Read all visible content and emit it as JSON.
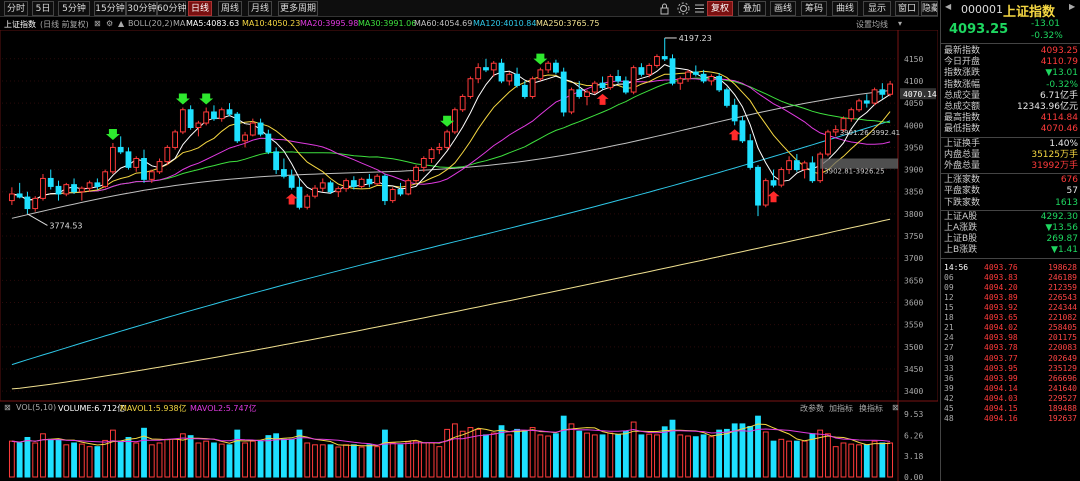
{
  "toolbar": {
    "periods": [
      "分时",
      "5日",
      "5分钟",
      "15分钟",
      "30分钟",
      "60分钟",
      "日线",
      "周线",
      "月线",
      "更多周期"
    ],
    "active_period": "日线",
    "right_buttons": [
      "复权",
      "叠加",
      "画线",
      "筹码",
      "曲线",
      "显示",
      "窗口",
      "隐藏"
    ],
    "active_right": "复权"
  },
  "infoline": {
    "name": "上证指数",
    "mode": "(日线  前复权)",
    "boll": "BOLL(20,2)",
    "ma_label": "MA",
    "ma5": "MA5:4083.63",
    "ma10": "MA10:4050.23",
    "ma20": "MA20:3995.98",
    "ma30": "MA30:3991.06",
    "ma60": "MA60:4054.69",
    "ma120": "MA120:4010.84",
    "ma250": "MA250:3765.75",
    "settings": "设置均线"
  },
  "chart_data": {
    "type": "candlestick",
    "title": "上证指数",
    "price_axis_ticks": [
      4150,
      4100,
      4050,
      4000,
      3950,
      3900,
      3850,
      3800,
      3750,
      3700,
      3650,
      3600,
      3550,
      3500,
      3450,
      3400
    ],
    "current_price_label": "4070.14",
    "annotations": [
      "4197.23",
      "3774.53",
      "3991.26-3992.41",
      "3902.81-3926.25"
    ],
    "ohlc": [
      [
        3830,
        3860,
        3820,
        3845
      ],
      [
        3845,
        3870,
        3835,
        3838
      ],
      [
        3838,
        3850,
        3800,
        3812
      ],
      [
        3812,
        3840,
        3805,
        3835
      ],
      [
        3835,
        3890,
        3830,
        3880
      ],
      [
        3880,
        3900,
        3855,
        3862
      ],
      [
        3862,
        3875,
        3830,
        3845
      ],
      [
        3845,
        3870,
        3840,
        3866
      ],
      [
        3866,
        3880,
        3845,
        3850
      ],
      [
        3850,
        3862,
        3830,
        3858
      ],
      [
        3858,
        3875,
        3850,
        3870
      ],
      [
        3870,
        3880,
        3855,
        3862
      ],
      [
        3862,
        3900,
        3858,
        3895
      ],
      [
        3895,
        3960,
        3890,
        3950
      ],
      [
        3950,
        3975,
        3935,
        3940
      ],
      [
        3940,
        3950,
        3900,
        3905
      ],
      [
        3905,
        3930,
        3895,
        3925
      ],
      [
        3925,
        3945,
        3870,
        3878
      ],
      [
        3878,
        3900,
        3870,
        3895
      ],
      [
        3895,
        3925,
        3890,
        3918
      ],
      [
        3918,
        3955,
        3910,
        3950
      ],
      [
        3950,
        3990,
        3945,
        3985
      ],
      [
        3985,
        4040,
        3980,
        4035
      ],
      [
        4035,
        4045,
        3990,
        3995
      ],
      [
        3995,
        4010,
        3975,
        4005
      ],
      [
        4005,
        4040,
        4000,
        4030
      ],
      [
        4030,
        4045,
        4010,
        4015
      ],
      [
        4015,
        4040,
        4008,
        4035
      ],
      [
        4035,
        4050,
        4020,
        4025
      ],
      [
        4025,
        4030,
        3960,
        3965
      ],
      [
        3965,
        3985,
        3950,
        3978
      ],
      [
        3978,
        4015,
        3975,
        4005
      ],
      [
        4005,
        4015,
        3975,
        3980
      ],
      [
        3980,
        3990,
        3935,
        3940
      ],
      [
        3940,
        3950,
        3890,
        3900
      ],
      [
        3900,
        3925,
        3880,
        3885
      ],
      [
        3885,
        3900,
        3855,
        3860
      ],
      [
        3860,
        3880,
        3810,
        3815
      ],
      [
        3815,
        3845,
        3810,
        3840
      ],
      [
        3840,
        3865,
        3835,
        3858
      ],
      [
        3858,
        3880,
        3850,
        3870
      ],
      [
        3870,
        3875,
        3845,
        3850
      ],
      [
        3850,
        3862,
        3838,
        3857
      ],
      [
        3857,
        3880,
        3850,
        3875
      ],
      [
        3875,
        3885,
        3855,
        3862
      ],
      [
        3862,
        3882,
        3858,
        3878
      ],
      [
        3878,
        3890,
        3860,
        3868
      ],
      [
        3868,
        3890,
        3865,
        3885
      ],
      [
        3885,
        3890,
        3820,
        3830
      ],
      [
        3830,
        3860,
        3825,
        3855
      ],
      [
        3855,
        3870,
        3840,
        3845
      ],
      [
        3845,
        3880,
        3842,
        3875
      ],
      [
        3875,
        3910,
        3870,
        3905
      ],
      [
        3905,
        3930,
        3895,
        3925
      ],
      [
        3925,
        3950,
        3915,
        3945
      ],
      [
        3945,
        3960,
        3935,
        3950
      ],
      [
        3950,
        3990,
        3945,
        3985
      ],
      [
        3985,
        4040,
        3980,
        4035
      ],
      [
        4035,
        4070,
        4030,
        4065
      ],
      [
        4065,
        4110,
        4060,
        4105
      ],
      [
        4105,
        4140,
        4095,
        4130
      ],
      [
        4130,
        4150,
        4120,
        4125
      ],
      [
        4125,
        4145,
        4110,
        4140
      ],
      [
        4140,
        4150,
        4095,
        4100
      ],
      [
        4100,
        4120,
        4090,
        4115
      ],
      [
        4115,
        4130,
        4085,
        4090
      ],
      [
        4090,
        4100,
        4060,
        4065
      ],
      [
        4065,
        4110,
        4060,
        4105
      ],
      [
        4105,
        4130,
        4100,
        4125
      ],
      [
        4125,
        4145,
        4118,
        4140
      ],
      [
        4140,
        4148,
        4115,
        4120
      ],
      [
        4120,
        4130,
        4020,
        4030
      ],
      [
        4030,
        4085,
        4025,
        4080
      ],
      [
        4080,
        4100,
        4060,
        4065
      ],
      [
        4065,
        4080,
        4045,
        4075
      ],
      [
        4075,
        4100,
        4070,
        4095
      ],
      [
        4095,
        4110,
        4080,
        4085
      ],
      [
        4085,
        4115,
        4080,
        4110
      ],
      [
        4110,
        4125,
        4095,
        4100
      ],
      [
        4100,
        4110,
        4070,
        4075
      ],
      [
        4075,
        4135,
        4070,
        4130
      ],
      [
        4130,
        4140,
        4110,
        4115
      ],
      [
        4115,
        4140,
        4108,
        4135
      ],
      [
        4135,
        4160,
        4130,
        4155
      ],
      [
        4155,
        4197,
        4145,
        4150
      ],
      [
        4150,
        4160,
        4090,
        4095
      ],
      [
        4095,
        4110,
        4080,
        4105
      ],
      [
        4105,
        4125,
        4098,
        4120
      ],
      [
        4120,
        4135,
        4110,
        4115
      ],
      [
        4115,
        4125,
        4095,
        4100
      ],
      [
        4100,
        4115,
        4090,
        4110
      ],
      [
        4110,
        4118,
        4075,
        4080
      ],
      [
        4080,
        4085,
        4040,
        4045
      ],
      [
        4045,
        4060,
        4000,
        4010
      ],
      [
        4010,
        4020,
        3960,
        3965
      ],
      [
        3965,
        3980,
        3900,
        3905
      ],
      [
        3905,
        3910,
        3795,
        3820
      ],
      [
        3820,
        3880,
        3815,
        3875
      ],
      [
        3875,
        3900,
        3860,
        3865
      ],
      [
        3865,
        3905,
        3860,
        3900
      ],
      [
        3900,
        3930,
        3890,
        3920
      ],
      [
        3920,
        3935,
        3895,
        3900
      ],
      [
        3900,
        3920,
        3880,
        3915
      ],
      [
        3915,
        3930,
        3870,
        3875
      ],
      [
        3875,
        3940,
        3870,
        3935
      ],
      [
        3935,
        3990,
        3930,
        3985
      ],
      [
        3985,
        4000,
        3975,
        3990
      ],
      [
        3990,
        4020,
        3985,
        4015
      ],
      [
        4015,
        4040,
        4008,
        4035
      ],
      [
        4035,
        4060,
        4030,
        4055
      ],
      [
        4055,
        4070,
        4040,
        4050
      ],
      [
        4050,
        4085,
        4045,
        4080
      ],
      [
        4080,
        4095,
        4060,
        4070
      ],
      [
        4070,
        4100,
        4065,
        4093
      ]
    ],
    "volume_axis_ticks": [
      "9.53",
      "6.26",
      "3.18",
      "0.00"
    ],
    "volume_header": [
      "VOL(5,10)",
      "VOLUME:6.712亿",
      "MAVOL1:5.938亿",
      "MAVOL2:5.747亿"
    ],
    "volume_right_labels": [
      "改参数",
      "加指标",
      "换指标"
    ]
  },
  "colors": {
    "up": "#ff3b3b",
    "down": "#1ee0ff",
    "ma5": "#ffffff",
    "ma10": "#f5d742",
    "ma20": "#e03ae0",
    "ma30": "#3ee03e",
    "ma60": "#c0c0c0",
    "ma120": "#2ec8e8",
    "ma250": "#f0e090"
  },
  "rpanel": {
    "code": "000001",
    "name": "上证指数",
    "price": "4093.25",
    "change": "-13.01",
    "change_pct": "-0.32%",
    "stats": [
      {
        "label": "最新指数",
        "value": "4093.25",
        "color": "red"
      },
      {
        "label": "今日开盘",
        "value": "4110.79",
        "color": "red"
      },
      {
        "label": "指数涨跌",
        "value": "▼13.01",
        "color": "green"
      },
      {
        "label": "指数涨幅",
        "value": "-0.32%",
        "color": "green"
      },
      {
        "label": "总成交量",
        "value": "6.71亿手",
        "color": "white"
      },
      {
        "label": "总成交额",
        "value": "12343.96亿元",
        "color": "white"
      },
      {
        "label": "最高指数",
        "value": "4114.84",
        "color": "red"
      },
      {
        "label": "最低指数",
        "value": "4070.46",
        "color": "red"
      }
    ],
    "stats2": [
      {
        "label": "上证换手",
        "value": "1.40%",
        "color": "white"
      },
      {
        "label": "内盘总量",
        "value": "35125万手",
        "color": "yellow"
      },
      {
        "label": "外盘总量",
        "value": "31992万手",
        "color": "red"
      }
    ],
    "stats3": [
      {
        "label": "上涨家数",
        "value": "676",
        "color": "red"
      },
      {
        "label": "平盘家数",
        "value": "57",
        "color": "white"
      },
      {
        "label": "下跌家数",
        "value": "1613",
        "color": "green"
      }
    ],
    "stats4": [
      {
        "label": "上证A股",
        "value": "4292.30",
        "color": "green"
      },
      {
        "label": "上A涨跌",
        "value": "▼13.56",
        "color": "green"
      },
      {
        "label": "上证B股",
        "value": "269.87",
        "color": "green"
      },
      {
        "label": "上B涨跌",
        "value": "▼1.41",
        "color": "green"
      }
    ],
    "ticks": [
      {
        "t": "14:56",
        "p": "4093.76",
        "v": "198628"
      },
      {
        "t": "06",
        "p": "4093.83",
        "v": "246189"
      },
      {
        "t": "09",
        "p": "4094.20",
        "v": "212359"
      },
      {
        "t": "12",
        "p": "4093.89",
        "v": "226543"
      },
      {
        "t": "15",
        "p": "4093.92",
        "v": "224344"
      },
      {
        "t": "18",
        "p": "4093.65",
        "v": "221082"
      },
      {
        "t": "21",
        "p": "4094.02",
        "v": "258405"
      },
      {
        "t": "24",
        "p": "4093.98",
        "v": "201175"
      },
      {
        "t": "27",
        "p": "4093.78",
        "v": "220083"
      },
      {
        "t": "30",
        "p": "4093.77",
        "v": "202649"
      },
      {
        "t": "33",
        "p": "4093.95",
        "v": "235129"
      },
      {
        "t": "36",
        "p": "4093.99",
        "v": "266696"
      },
      {
        "t": "39",
        "p": "4094.14",
        "v": "241640"
      },
      {
        "t": "42",
        "p": "4094.03",
        "v": "229527"
      },
      {
        "t": "45",
        "p": "4094.15",
        "v": "189488"
      },
      {
        "t": "48",
        "p": "4094.16",
        "v": "192637"
      }
    ]
  }
}
